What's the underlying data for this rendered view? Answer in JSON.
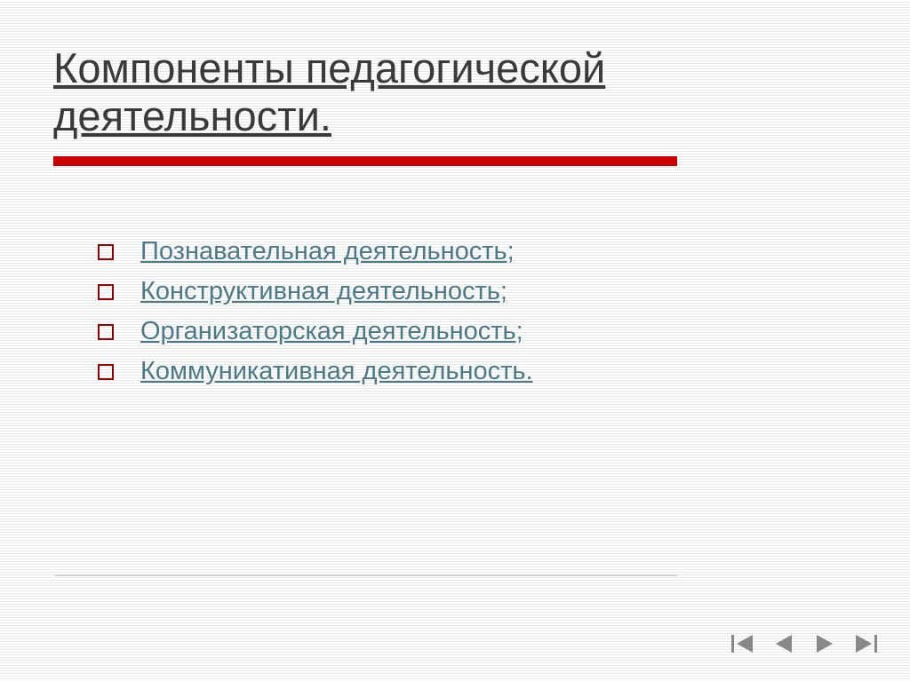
{
  "title": "Компоненты педагогической деятельности.",
  "bullets": {
    "0": "Познавательная деятельность;",
    "1": "Конструктивная деятельность;",
    "2": "Организаторская деятельность;",
    "3": "Коммуникативная деятельность."
  },
  "colors": {
    "accent": "#cc0000",
    "link": "#4a7a8a",
    "bullet_border": "#990000",
    "nav": "#888888"
  }
}
